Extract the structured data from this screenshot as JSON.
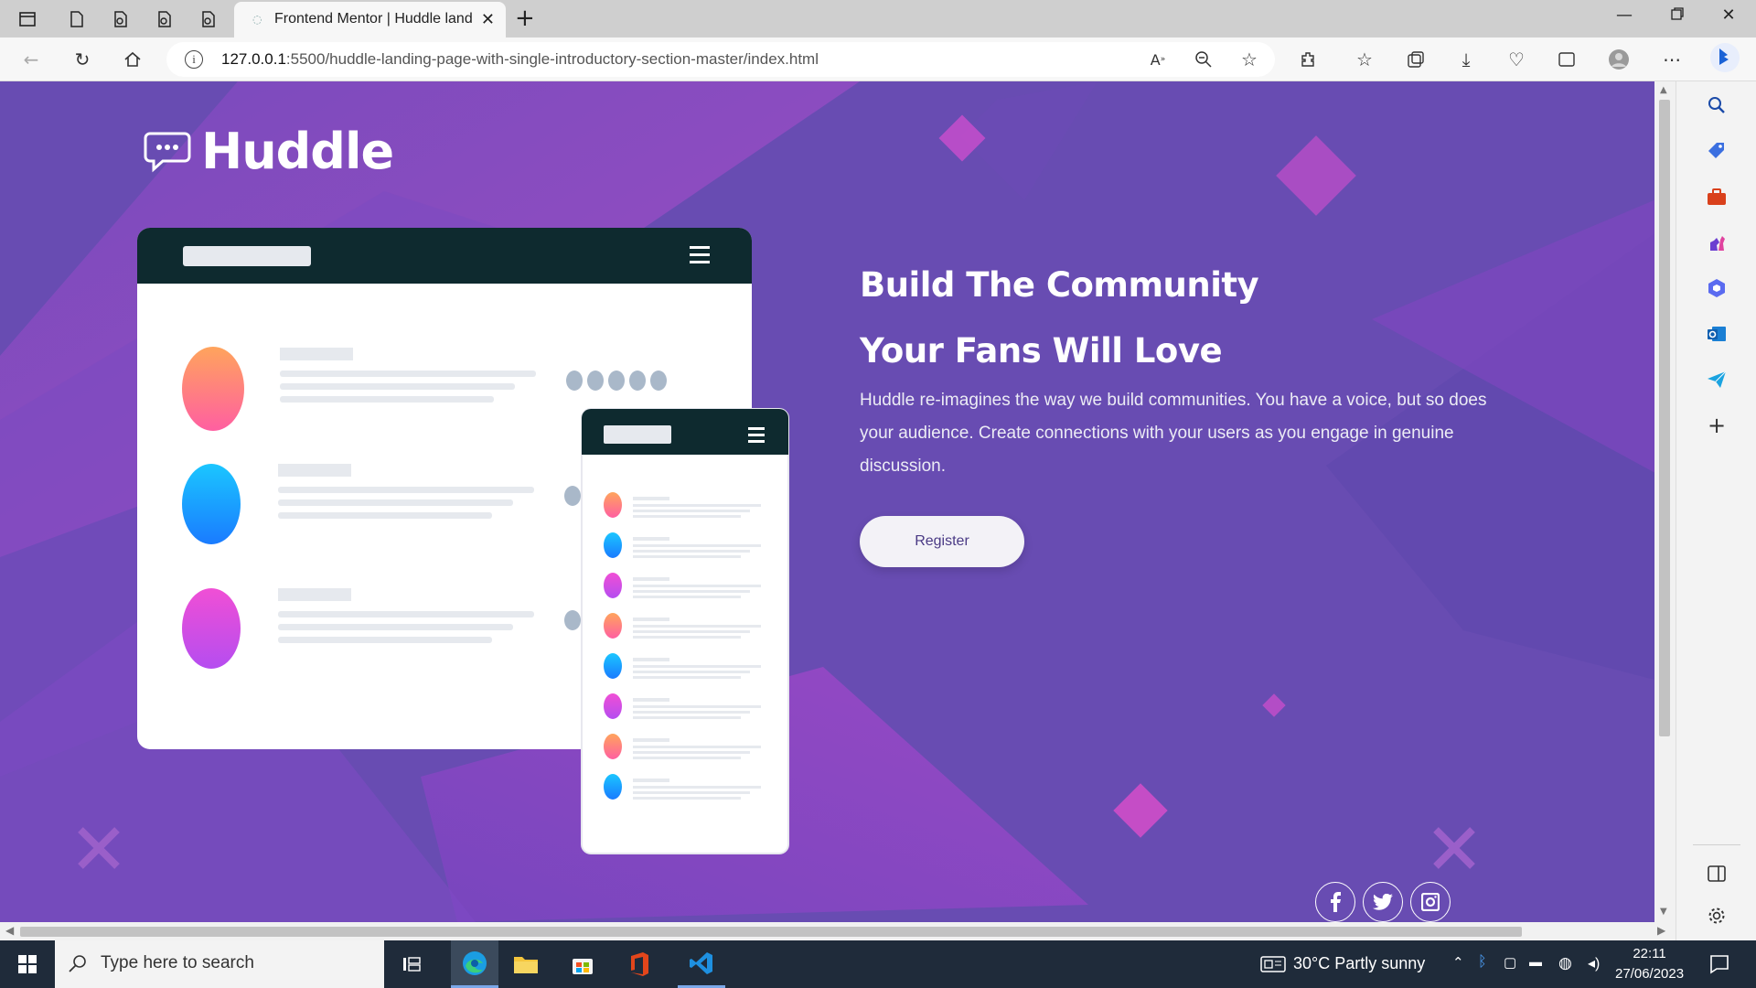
{
  "browser": {
    "tab_title": "Frontend Mentor | Huddle landin",
    "url_host": "127.0.0.1",
    "url_rest": ":5500/huddle-landing-page-with-single-introductory-section-master/index.html"
  },
  "page": {
    "brand": "Huddle",
    "headline_line1": "Build The Community",
    "headline_line2": "Your Fans Will Love",
    "description": "Huddle re-imagines the way we build communities. You have a voice, but so does your audience. Create connections with your users as you engage in genuine discussion.",
    "register_label": "Register",
    "social": [
      "facebook-icon",
      "twitter-icon",
      "instagram-icon"
    ]
  },
  "taskbar": {
    "search_placeholder": "Type here to search",
    "weather": "30°C  Partly sunny",
    "time": "22:11",
    "date": "27/06/2023"
  },
  "colors": {
    "background": "#6a4bb3",
    "accent_pink": "#d052cf",
    "dark_bar": "#0e2a2f"
  }
}
